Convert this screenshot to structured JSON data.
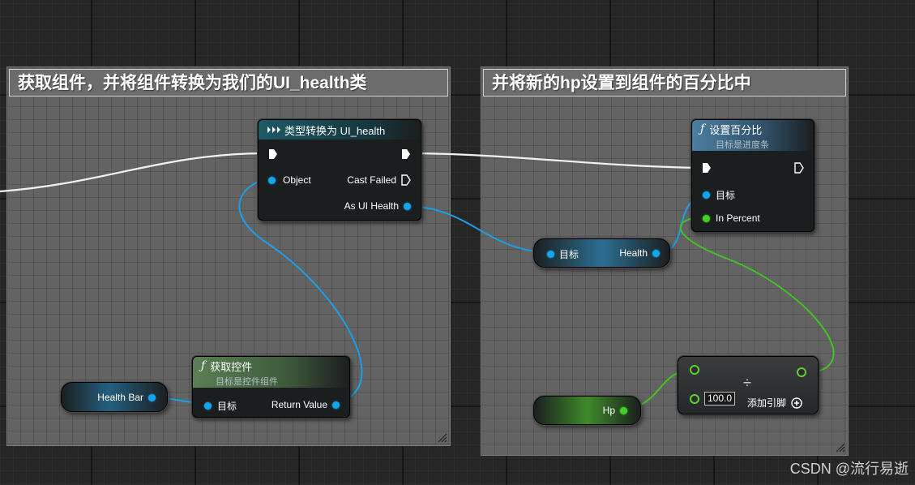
{
  "comments": {
    "left_title": "获取组件，并将组件转换为我们的UI_health类",
    "right_title": "并将新的hp设置到组件的百分比中"
  },
  "cast_node": {
    "title": "类型转换为 UI_health",
    "object_pin": "Object",
    "cast_failed_pin": "Cast Failed",
    "as_pin": "As UI Health"
  },
  "get_widget_node": {
    "title": "获取控件",
    "subtitle": "目标是控件组件",
    "target_pin": "目标",
    "return_pin": "Return Value"
  },
  "health_bar_var": {
    "label": "Health Bar"
  },
  "set_percent_node": {
    "title": "设置百分比",
    "subtitle": "目标是进度条",
    "target_pin": "目标",
    "percent_pin": "In Percent"
  },
  "health_getter": {
    "target_pin": "目标",
    "output_pin": "Health"
  },
  "divide_node": {
    "symbol": "÷",
    "input_value": "100.0",
    "add_pin_label": "添加引脚"
  },
  "hp_var": {
    "label": "Hp"
  },
  "watermark": "CSDN @流行易逝",
  "colors": {
    "object_pin": "#13a5ee",
    "float_pin": "#43d026",
    "exec_wire": "#ffffff",
    "cast_header": "#1e5a66",
    "function_header_blue": "#3d6f8e",
    "function_header_green": "#4f7a4a"
  }
}
